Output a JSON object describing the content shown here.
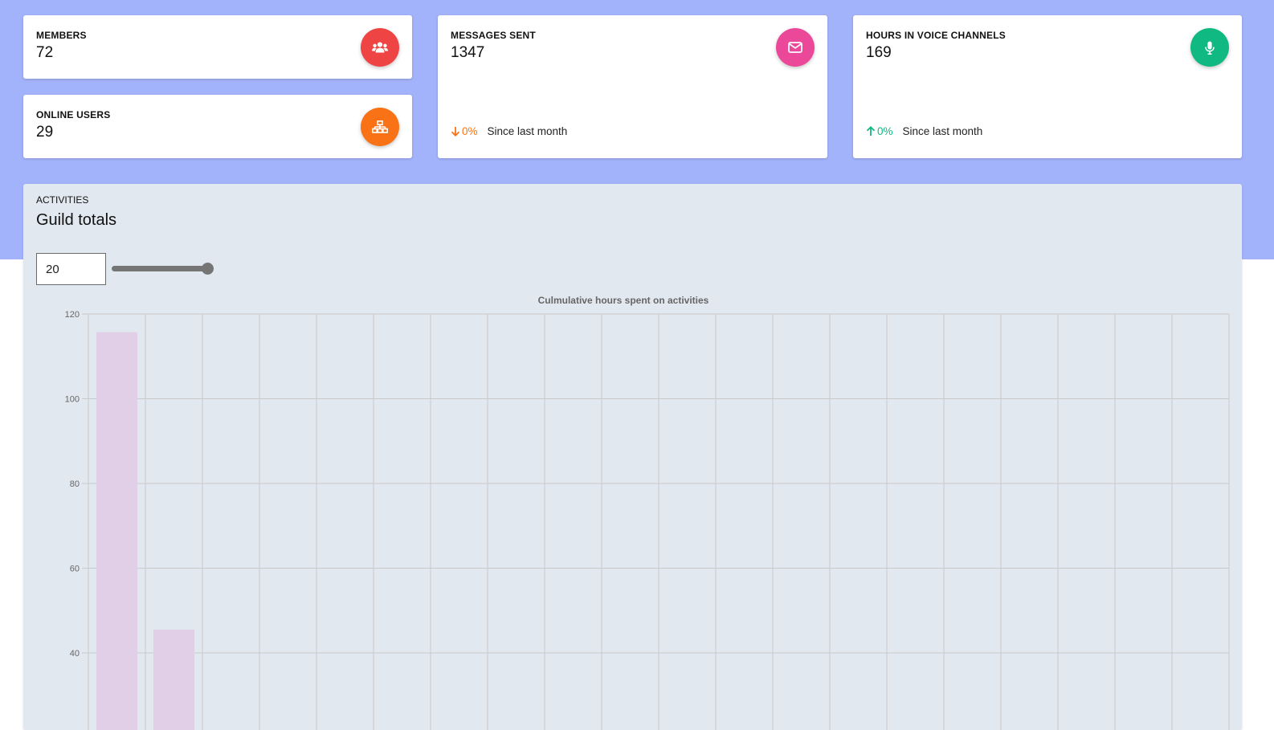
{
  "stats": {
    "members": {
      "label": "MEMBERS",
      "value": "72",
      "icon": "users-icon",
      "color": "#ef4444"
    },
    "online": {
      "label": "ONLINE USERS",
      "value": "29",
      "icon": "sitemap-icon",
      "color": "#f97316"
    },
    "messages": {
      "label": "MESSAGES SENT",
      "value": "1347",
      "icon": "envelope-icon",
      "color": "#ec4899",
      "trend": {
        "direction": "down",
        "percent": "0%",
        "since": "Since last month",
        "color": "#f97316"
      }
    },
    "voice": {
      "label": "HOURS IN VOICE CHANNELS",
      "value": "169",
      "icon": "microphone-icon",
      "color": "#10b981",
      "trend": {
        "direction": "up",
        "percent": "0%",
        "since": "Since last month",
        "color": "#10b981"
      }
    }
  },
  "activities": {
    "overline": "ACTIVITIES",
    "title": "Guild totals",
    "limit_input": {
      "value": "20"
    },
    "slider": {
      "value": 20,
      "min": 0,
      "max": 20
    }
  },
  "chart_data": {
    "type": "bar",
    "title": "Culmulative hours spent on activities",
    "y_ticks": [
      120,
      100,
      80,
      60,
      40
    ],
    "ylim_visible": [
      27,
      120
    ],
    "categories_visible": 20,
    "values": [
      115.7,
      45.5
    ],
    "bar_color": "#e0cfe6",
    "grid": true
  }
}
